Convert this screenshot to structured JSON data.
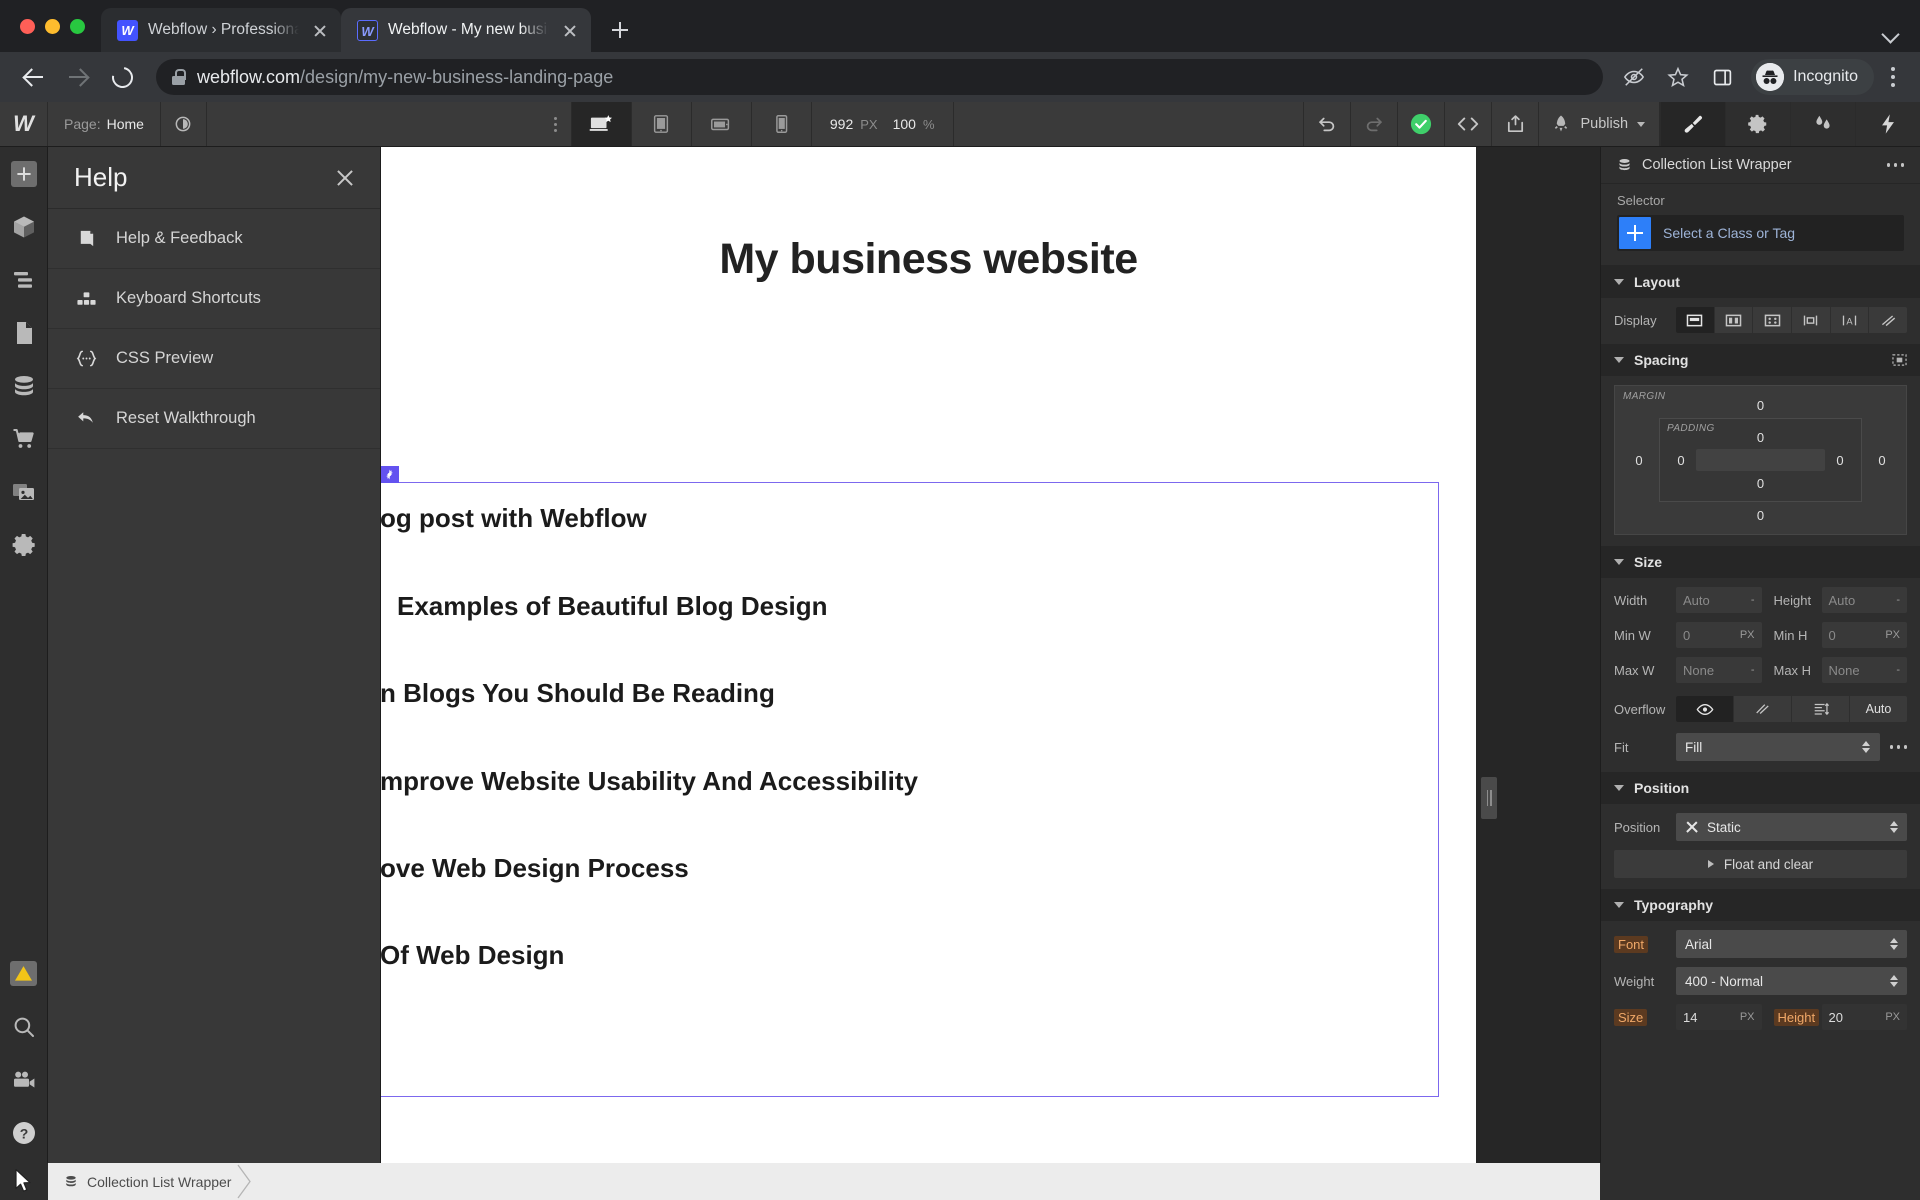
{
  "browser": {
    "tabs": [
      {
        "title": "Webflow › Professional Freelan",
        "favicon": "webflow-favicon",
        "active": false
      },
      {
        "title": "Webflow - My new business lan",
        "favicon": "webflow-favicon",
        "active": true
      }
    ],
    "new_tab_label": "+",
    "url_domain": "webflow.com",
    "url_path": "/design/my-new-business-landing-page",
    "profile_label": "Incognito",
    "toolbar_icons": [
      "eye-slash-icon",
      "star-icon",
      "side-panel-icon",
      "incognito-icon",
      "kebab-menu-icon"
    ]
  },
  "webflow": {
    "topbar": {
      "logo": "W",
      "page_label": "Page:",
      "page_value": "Home",
      "breakpoints": [
        {
          "name": "desktop",
          "active": true
        },
        {
          "name": "tablet",
          "active": false
        },
        {
          "name": "mobile-landscape",
          "active": false
        },
        {
          "name": "mobile-portrait",
          "active": false
        }
      ],
      "canvas_width": "992",
      "canvas_width_unit": "PX",
      "zoom_value": "100",
      "zoom_unit": "%",
      "actions": [
        "undo-icon",
        "redo-icon",
        "saved-check-icon",
        "code-icon",
        "share-icon"
      ],
      "publish_label": "Publish",
      "right_tabs": [
        "style-brush-icon",
        "settings-gear-icon",
        "interactions-icon",
        "flash-icon"
      ]
    },
    "rail": {
      "top_items": [
        "add-element-icon",
        "components-icon",
        "navigator-icon",
        "pages-icon",
        "cms-collections-icon",
        "ecommerce-icon",
        "assets-icon",
        "site-settings-icon"
      ],
      "bottom_items": [
        "audit-warning-icon",
        "search-icon",
        "video-tutorials-icon",
        "help-icon"
      ]
    },
    "help_panel": {
      "title": "Help",
      "close_label": "close-icon",
      "items": [
        {
          "label": "Help & Feedback",
          "icon": "book-icon"
        },
        {
          "label": "Keyboard Shortcuts",
          "icon": "keyboard-icon"
        },
        {
          "label": "CSS Preview",
          "icon": "css-braces-icon"
        },
        {
          "label": "Reset Walkthrough",
          "icon": "reset-arrow-icon"
        }
      ]
    },
    "canvas": {
      "heading": "My business website",
      "collection_badge_icon": "cog-icon",
      "blog_items": [
        "og post with Webflow",
        "Examples of Beautiful Blog Design",
        "n Blogs You Should Be Reading",
        "mprove Website Usability And Accessibility",
        "ove Web Design Process",
        "Of Web Design"
      ],
      "selection_color": "#7c68ee"
    },
    "right_panel": {
      "element_name": "Collection List Wrapper",
      "element_icon": "cms-collection-icon",
      "more_icon": "ellipsis-icon",
      "selector": {
        "label": "Selector",
        "placeholder": "Select a Class or Tag",
        "add_icon": "plus-icon"
      },
      "layout": {
        "title": "Layout",
        "display_label": "Display",
        "display_options": [
          {
            "name": "block",
            "active": true
          },
          {
            "name": "flex",
            "active": false
          },
          {
            "name": "grid",
            "active": false
          },
          {
            "name": "inline-block",
            "active": false
          },
          {
            "name": "inline",
            "active": false
          },
          {
            "name": "none",
            "active": false
          }
        ]
      },
      "spacing": {
        "title": "Spacing",
        "expand_icon": "expand-spacing-icon",
        "margin_label": "MARGIN",
        "padding_label": "PADDING",
        "margin": {
          "top": "0",
          "right": "0",
          "bottom": "0",
          "left": "0"
        },
        "padding": {
          "top": "0",
          "right": "0",
          "bottom": "0",
          "left": "0"
        }
      },
      "size": {
        "title": "Size",
        "width_label": "Width",
        "width_value": "Auto",
        "width_unit": "-",
        "height_label": "Height",
        "height_value": "Auto",
        "height_unit": "-",
        "min_w_label": "Min W",
        "min_w_value": "0",
        "min_w_unit": "PX",
        "min_h_label": "Min H",
        "min_h_value": "0",
        "min_h_unit": "PX",
        "max_w_label": "Max W",
        "max_w_value": "None",
        "max_w_unit": "-",
        "max_h_label": "Max H",
        "max_h_value": "None",
        "max_h_unit": "-",
        "overflow_label": "Overflow",
        "overflow_options": [
          {
            "name": "visible",
            "label": "",
            "active": true
          },
          {
            "name": "hidden",
            "label": "",
            "active": false
          },
          {
            "name": "scroll",
            "label": "",
            "active": false
          },
          {
            "name": "auto",
            "label": "Auto",
            "active": false
          }
        ],
        "fit_label": "Fit",
        "fit_value": "Fill",
        "fit_more_icon": "ellipsis-icon"
      },
      "position": {
        "title": "Position",
        "position_label": "Position",
        "position_value": "Static",
        "clear_icon": "x-icon",
        "float_label": "Float and clear"
      },
      "typography": {
        "title": "Typography",
        "font_label": "Font",
        "font_value": "Arial",
        "weight_label": "Weight",
        "weight_value": "400 - Normal",
        "size_label": "Size",
        "size_value": "14",
        "size_unit": "PX",
        "height_label": "Height",
        "height_value": "20",
        "height_unit": "PX"
      }
    },
    "statusbar": {
      "breadcrumb": "Collection List Wrapper",
      "breadcrumb_icon": "cms-collection-icon"
    }
  }
}
